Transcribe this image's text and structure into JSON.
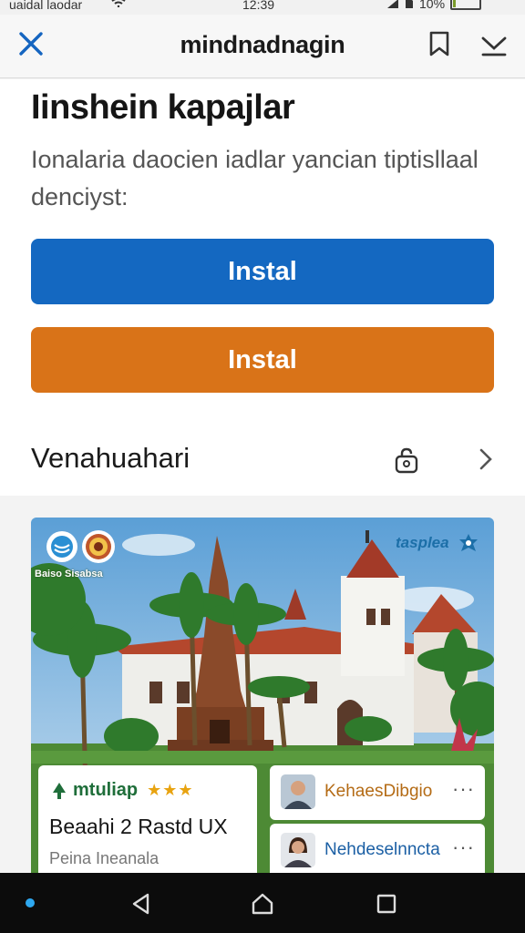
{
  "status_bar": {
    "carrier": "uaidal laodar",
    "time": "12:39",
    "battery": "10%",
    "battery_level": 0.1
  },
  "app_bar": {
    "title": "mindnadnagin"
  },
  "main": {
    "heading": "Iinshein kapajlar",
    "description": "Ionalaria daocien iadlar yancian tiptisllaal denciyst:",
    "primary_button": "Instal",
    "secondary_button": "Instal",
    "section_title": "Venahuahari"
  },
  "hero": {
    "logo_caption": "Baiso Sisabsa",
    "tag_text": "tasplea",
    "card_left": {
      "meta_name": "mtuliap",
      "stars": "★★★",
      "title": "Beaahi 2 Rastd UX",
      "subtitle": "Peina Ineanala"
    },
    "card_right": [
      {
        "name": "KehaesDibgio",
        "more": "···"
      },
      {
        "name": "Nehdeselnncta",
        "more": "···"
      }
    ]
  },
  "colors": {
    "primary_blue": "#1468c1",
    "primary_orange": "#d97318",
    "nav_background": "#0c0c0c"
  }
}
